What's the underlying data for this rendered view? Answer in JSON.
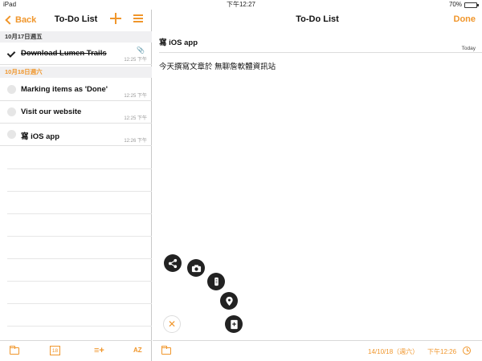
{
  "status_bar": {
    "device": "iPad",
    "time": "下午12:27",
    "battery_text": "70%",
    "battery_level": 0.7
  },
  "list_panel": {
    "back_label": "Back",
    "title": "To-Do List",
    "sections": [
      {
        "header": "10月17日週五"
      },
      {
        "header": "10月18日週六"
      }
    ],
    "tasks": [
      {
        "title": "Download Lumen Trails",
        "time": "12:25 下午",
        "done": true
      },
      {
        "title": "Marking items as 'Done'",
        "time": "12:25 下午",
        "done": false
      },
      {
        "title": "Visit our website",
        "time": "12:25 下午",
        "done": false
      },
      {
        "title": "寫 iOS app",
        "time": "12:26 下午",
        "done": false
      }
    ],
    "toolbar": {
      "calendar_day": "18",
      "sort_label": "AZ"
    }
  },
  "detail_panel": {
    "title": "To-Do List",
    "done_label": "Done",
    "note_title": "寫 iOS app",
    "note_date": "Today",
    "note_body": "今天撰寫文章於 無聊詹軟體資訊站",
    "footer_date": "14/10/18（週六）",
    "footer_time": "下午12:26"
  },
  "colors": {
    "accent": "#f0962b",
    "fab": "#222222"
  },
  "icons": [
    "share-icon",
    "camera-icon",
    "audio-icon",
    "location-icon",
    "contact-icon",
    "close-icon",
    "folder-icon",
    "calendar-icon",
    "add-list-icon",
    "sort-icon",
    "clock-icon",
    "paperclip-icon"
  ]
}
